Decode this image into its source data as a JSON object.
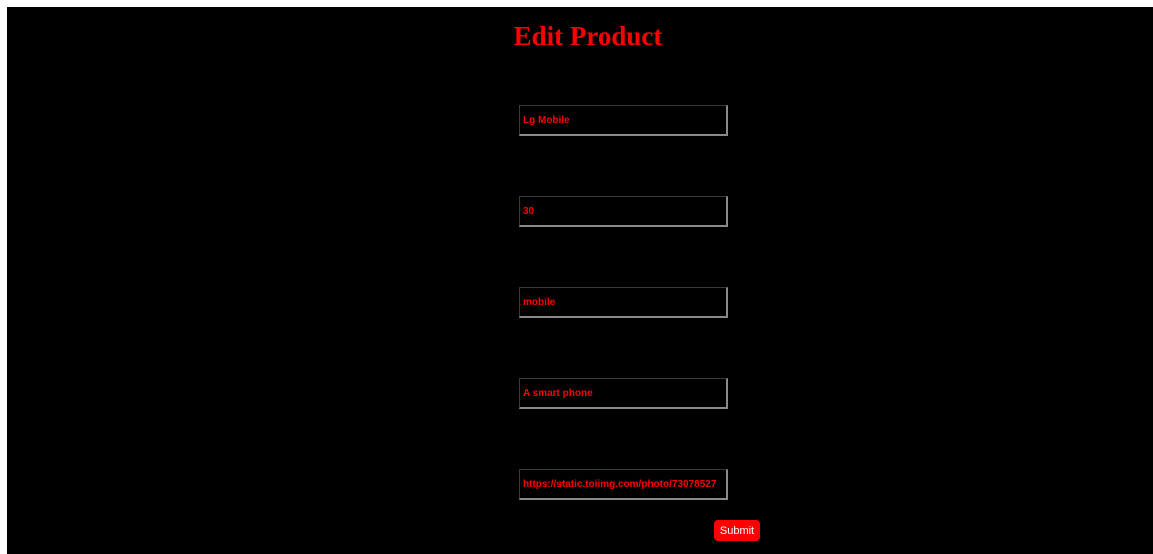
{
  "page": {
    "title": "Edit Product",
    "background": "#000000",
    "accent": "#ff0000"
  },
  "form": {
    "fields": [
      {
        "name": "product-name",
        "value": "Lg Mobile"
      },
      {
        "name": "price",
        "value": "30"
      },
      {
        "name": "category",
        "value": "mobile"
      },
      {
        "name": "description",
        "value": "A smart phone"
      },
      {
        "name": "image-url",
        "value": "https://static.toiimg.com/photo/73078527"
      }
    ],
    "submit_label": "Submit"
  }
}
